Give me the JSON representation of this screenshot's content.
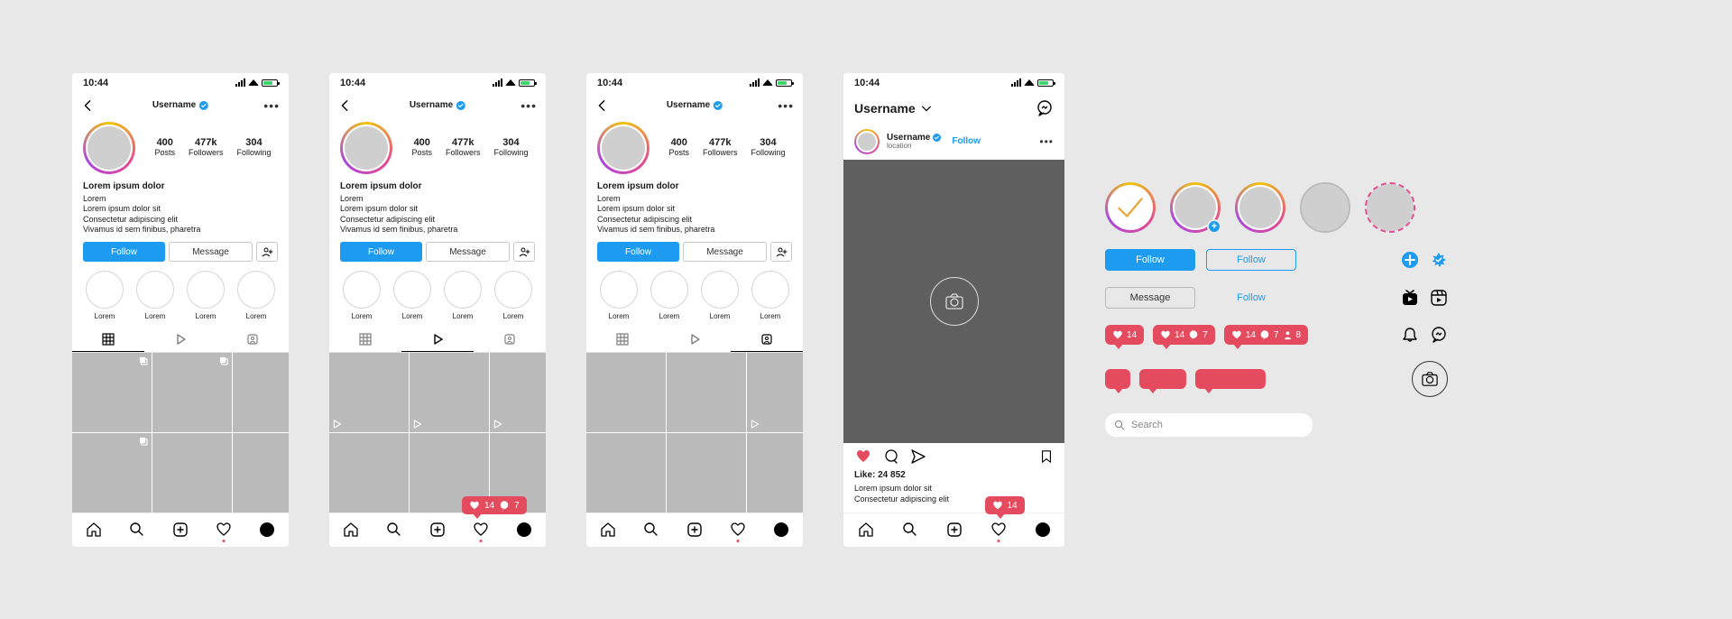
{
  "status": {
    "time": "10:44"
  },
  "profile": {
    "username": "Username",
    "stats": {
      "posts": "400",
      "posts_lbl": "Posts",
      "followers": "477k",
      "followers_lbl": "Followers",
      "following": "304",
      "following_lbl": "Following"
    },
    "bio_title": "Lorem ipsum dolor",
    "bio_l1": "Lorem",
    "bio_l2": "Lorem ipsum dolor sit",
    "bio_l3": "Consectetur adipiscing elit",
    "bio_l4": "Vivamus id sem finibus, pharetra",
    "follow_btn": "Follow",
    "message_btn": "Message",
    "highlight_lbl": "Lorem"
  },
  "post": {
    "username": "Username",
    "location": "location",
    "follow": "Follow",
    "likes": "Like: 24 852",
    "cap_l1": "Lorem ipsum dolor sit",
    "cap_l2": "Consectetur adipiscing elit"
  },
  "panel": {
    "follow": "Follow",
    "message": "Message",
    "search": "Search"
  },
  "bubbles": {
    "b14": "14",
    "b7": "7",
    "b8": "8"
  },
  "colors": {
    "blue": "#1d9bf0",
    "red": "#e54b5e"
  }
}
